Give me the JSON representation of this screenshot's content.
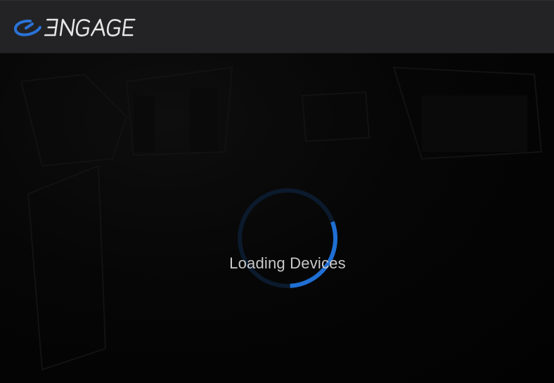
{
  "app": {
    "brand_name": "ENGAGE",
    "brand_color": "#2a73d8",
    "header_color": "#232325",
    "background_color": "#030303"
  },
  "loader": {
    "status_text": "Loading Devices",
    "spinner_color": "#1f6fd4",
    "spinner_track_color": "#0b1a2c",
    "progress_fraction": 0.27
  },
  "icons": {
    "logo": "engage-logo-icon",
    "spinner": "loading-spinner-icon"
  }
}
